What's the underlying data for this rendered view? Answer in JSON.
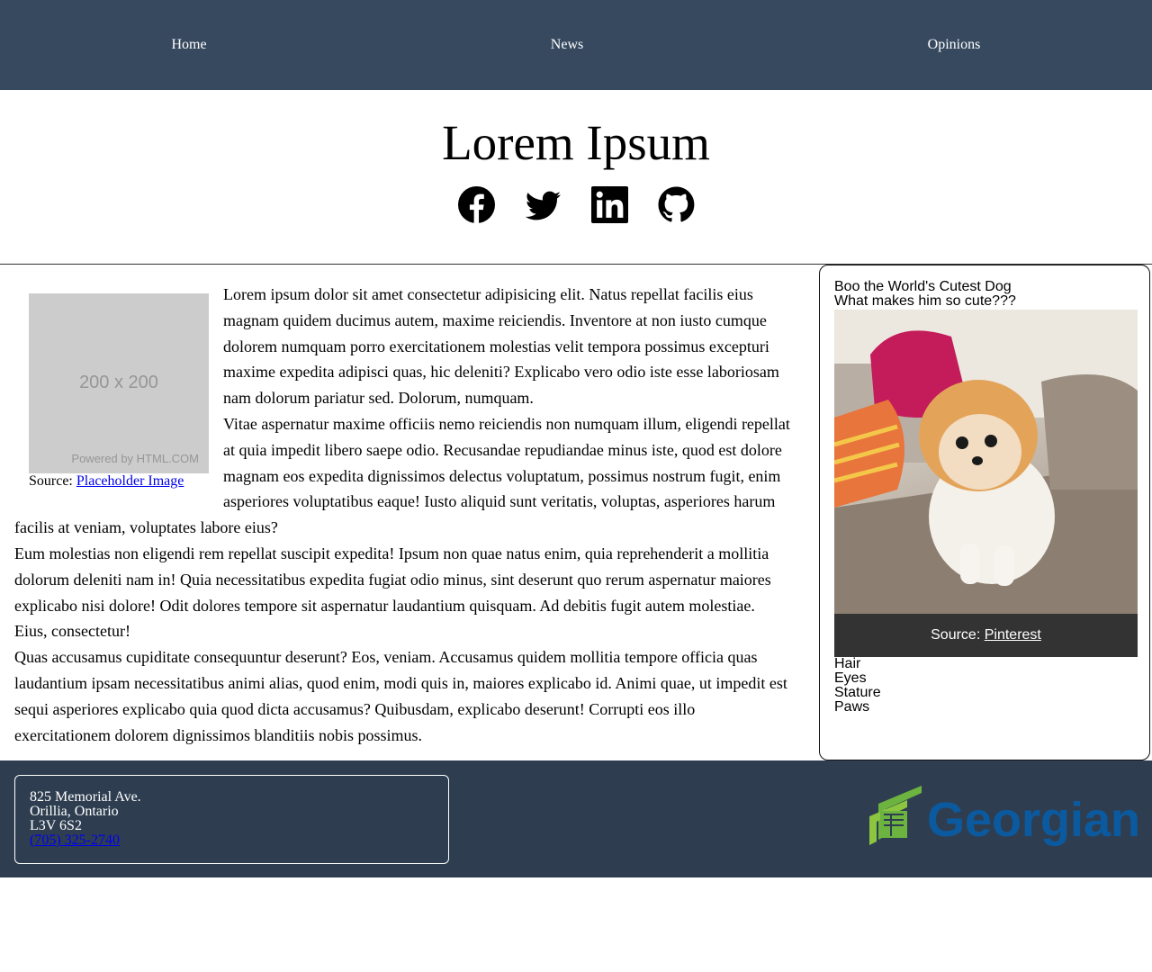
{
  "nav": {
    "items": [
      {
        "label": "Home"
      },
      {
        "label": "News"
      },
      {
        "label": "Opinions"
      }
    ]
  },
  "hero": {
    "title": "Lorem Ipsum",
    "socials": [
      {
        "icon": "facebook-icon"
      },
      {
        "icon": "twitter-icon"
      },
      {
        "icon": "linkedin-icon"
      },
      {
        "icon": "github-icon"
      }
    ]
  },
  "figure": {
    "placeholder_size": "200 x 200",
    "placeholder_powered": "Powered by HTML.COM",
    "caption_prefix": "Source:",
    "caption_link": "Placeholder Image"
  },
  "article": {
    "paragraphs": [
      "Lorem ipsum dolor sit amet consectetur adipisicing elit. Natus repellat facilis eius magnam quidem ducimus autem, maxime reiciendis. Inventore at non iusto cumque dolorem numquam porro exercitationem molestias velit tempora possimus excepturi maxime expedita adipisci quas, hic deleniti? Explicabo vero odio iste esse laboriosam nam dolorum pariatur sed. Dolorum, numquam.",
      "Vitae aspernatur maxime officiis nemo reiciendis non numquam illum, eligendi repellat at quia impedit libero saepe odio. Recusandae repudiandae minus iste, quod est dolore magnam eos expedita dignissimos delectus voluptatum, possimus nostrum fugit, enim asperiores voluptatibus eaque! Iusto aliquid sunt veritatis, voluptas, asperiores harum facilis at veniam, voluptates labore eius?",
      "Eum molestias non eligendi rem repellat suscipit expedita! Ipsum non quae natus enim, quia reprehenderit a mollitia dolorum deleniti nam in! Quia necessitatibus expedita fugiat odio minus, sint deserunt quo rerum aspernatur maiores explicabo nisi dolore! Odit dolores tempore sit aspernatur laudantium quisquam. Ad debitis fugit autem molestiae. Eius, consectetur!",
      "Quas accusamus cupiditate consequuntur deserunt? Eos, veniam. Accusamus quidem mollitia tempore officia quas laudantium ipsam necessitatibus animi alias, quod enim, modi quis in, maiores explicabo id. Animi quae, ut impedit est sequi asperiores explicabo quia quod dicta accusamus? Quibusdam, explicabo deserunt! Corrupti eos illo exercitationem dolorem dignissimos blanditiis nobis possimus."
    ]
  },
  "aside": {
    "title": "Boo the World's Cutest Dog",
    "subtitle": "What makes him so cute???",
    "caption_prefix": "Source:",
    "caption_link": "Pinterest",
    "traits": [
      "Hair",
      "Eyes",
      "Stature",
      "Paws"
    ]
  },
  "footer": {
    "address_lines": [
      "825 Memorial Ave.",
      "Orillia, Ontario",
      "L3V 6S2"
    ],
    "phone": "(705) 325-2740",
    "logo_text": "Georgian"
  },
  "colors": {
    "nav_bg": "#36495f",
    "footer_bg": "#2e3e50",
    "logo_green": "#6cb33f",
    "logo_blue": "#0b5aa0"
  }
}
